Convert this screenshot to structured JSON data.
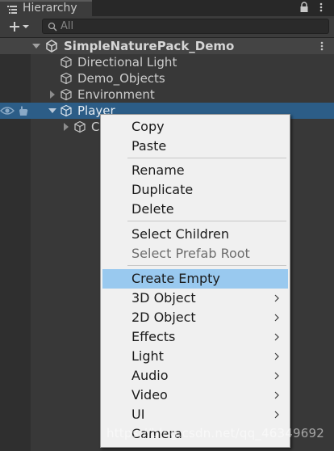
{
  "window": {
    "tab_label": "Hierarchy",
    "tab_icon": "hierarchy-list-icon",
    "lock_icon": "lock-icon",
    "more_icon": "kebab-menu-icon"
  },
  "toolbar": {
    "add_icon": "plus-dropdown-icon",
    "search_placeholder": "All",
    "search_icon": "search-icon"
  },
  "hierarchy": {
    "scene": {
      "label": "SimpleNaturePack_Demo",
      "icon": "unity-scene-icon",
      "expanded": true
    },
    "items": [
      {
        "label": "Directional Light",
        "icon": "cube-icon",
        "has_children": false
      },
      {
        "label": "Demo_Objects",
        "icon": "cube-icon",
        "has_children": false
      },
      {
        "label": "Environment",
        "icon": "cube-icon",
        "has_children": true,
        "expanded": false
      },
      {
        "label": "Player",
        "icon": "cube-icon",
        "has_children": true,
        "expanded": true,
        "selected": true
      },
      {
        "label": "C",
        "icon": "cube-icon",
        "has_children": true,
        "expanded": false
      }
    ]
  },
  "context_menu": {
    "items": [
      {
        "label": "Copy"
      },
      {
        "label": "Paste"
      },
      {
        "separator": true
      },
      {
        "label": "Rename"
      },
      {
        "label": "Duplicate"
      },
      {
        "label": "Delete"
      },
      {
        "separator": true
      },
      {
        "label": "Select Children"
      },
      {
        "label": "Select Prefab Root",
        "disabled": true
      },
      {
        "separator": true
      },
      {
        "label": "Create Empty",
        "highlighted": true
      },
      {
        "label": "3D Object",
        "submenu": true
      },
      {
        "label": "2D Object",
        "submenu": true
      },
      {
        "label": "Effects",
        "submenu": true
      },
      {
        "label": "Light",
        "submenu": true
      },
      {
        "label": "Audio",
        "submenu": true
      },
      {
        "label": "Video",
        "submenu": true
      },
      {
        "label": "UI",
        "submenu": true
      },
      {
        "label": "Camera"
      }
    ]
  },
  "watermark": "https://blog.csdn.net/qq_46349692",
  "colors": {
    "selection": "#2c5d87",
    "menu_highlight": "#99c9ef",
    "menu_bg": "#f0f0f0"
  }
}
